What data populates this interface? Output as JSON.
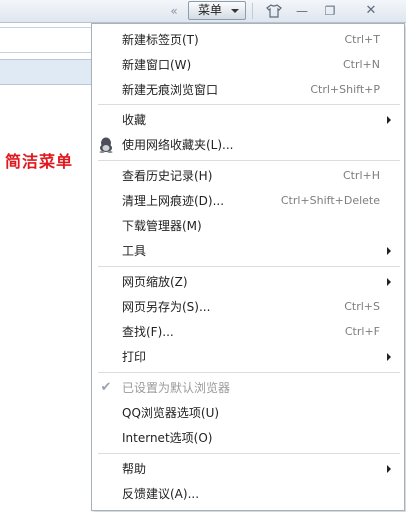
{
  "toolbar": {
    "chevron": "«",
    "menu_label": "菜单",
    "icons": [
      "shirt-icon",
      "minimize-icon",
      "restore-icon",
      "close-icon"
    ],
    "minimize_glyph": "—",
    "restore_glyph": "❐",
    "close_glyph": "✕"
  },
  "caption": "简洁菜单",
  "menu": {
    "items": [
      {
        "label": "新建标签页(T)",
        "shortcut": "Ctrl+T"
      },
      {
        "label": "新建窗口(W)",
        "shortcut": "Ctrl+N"
      },
      {
        "label": "新建无痕浏览窗口",
        "shortcut": "Ctrl+Shift+P"
      },
      {
        "label": "收藏",
        "submenu": true
      },
      {
        "label": "使用网络收藏夹(L)...",
        "icon": "qq-penguin-icon"
      },
      {
        "label": "查看历史记录(H)",
        "shortcut": "Ctrl+H"
      },
      {
        "label": "清理上网痕迹(D)...",
        "shortcut": "Ctrl+Shift+Delete"
      },
      {
        "label": "下载管理器(M)"
      },
      {
        "label": "工具",
        "submenu": true
      },
      {
        "label": "网页缩放(Z)",
        "submenu": true
      },
      {
        "label": "网页另存为(S)...",
        "shortcut": "Ctrl+S"
      },
      {
        "label": "查找(F)...",
        "shortcut": "Ctrl+F"
      },
      {
        "label": "打印",
        "submenu": true
      },
      {
        "label": "已设置为默认浏览器",
        "disabled": true,
        "checked": true
      },
      {
        "label": "QQ浏览器选项(U)"
      },
      {
        "label": "Internet选项(O)"
      },
      {
        "label": "帮助",
        "submenu": true
      },
      {
        "label": "反馈建议(A)..."
      }
    ]
  },
  "colors": {
    "caption": "#e0181e",
    "menu_border": "#a7b1bc",
    "shortcut": "#7d7d7d",
    "disabled": "#9a9a9a"
  }
}
